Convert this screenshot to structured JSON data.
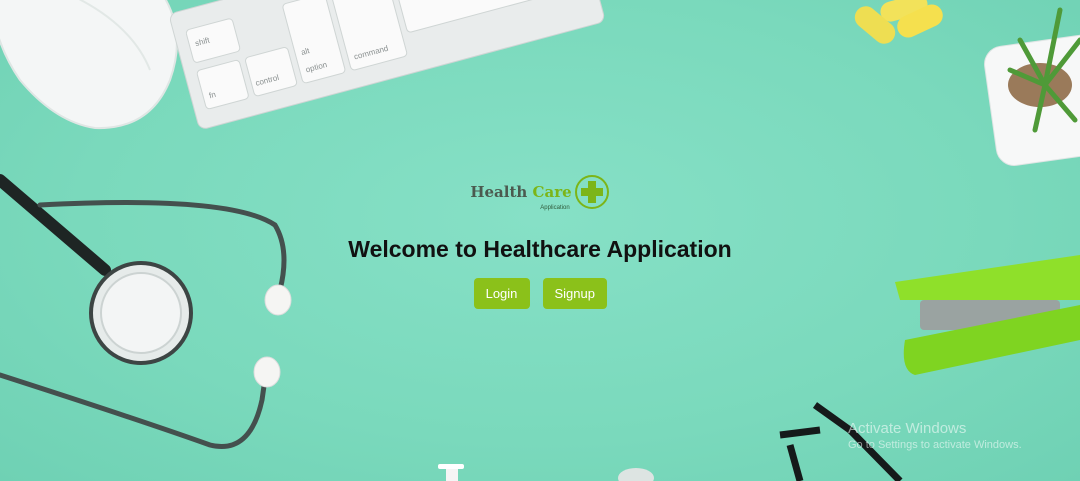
{
  "brand": {
    "logo_word_1": "Health",
    "logo_word_2": "Care",
    "logo_sub": "Application"
  },
  "hero": {
    "title": "Welcome to Healthcare Application"
  },
  "actions": {
    "login_label": "Login",
    "signup_label": "Signup"
  },
  "keyboard": {
    "keys": [
      "shift",
      "fn",
      "control",
      "alt",
      "option",
      "command"
    ]
  },
  "watermark": {
    "title": "Activate Windows",
    "subtitle": "Go to Settings to activate Windows."
  },
  "colors": {
    "background": "#7fdcc0",
    "accent": "#8bc11a",
    "logo_green": "#7cb518"
  }
}
